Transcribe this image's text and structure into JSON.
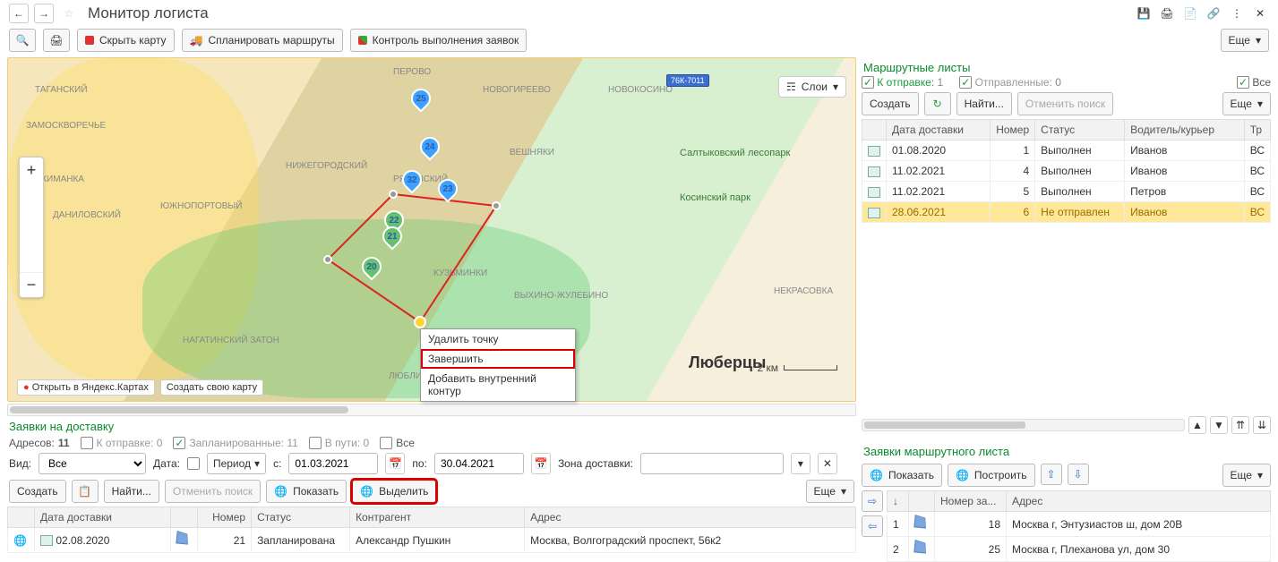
{
  "title": "Монитор логиста",
  "toolbar": {
    "hide_map": "Скрыть карту",
    "plan_routes": "Спланировать маршруты",
    "control_exec": "Контроль выполнения заявок",
    "more": "Еще"
  },
  "map": {
    "layers": "Слои",
    "context_menu": {
      "delete_point": "Удалить точку",
      "finish": "Завершить",
      "add_inner": "Добавить внутренний контур"
    },
    "open_yandex": "Открыть в Яндекс.Картах",
    "create_own": "Создать свою карту",
    "scale": "2 км",
    "city": "Люберцы",
    "park1": "Салтыковский лесопарк",
    "park2": "Косинский парк",
    "road_badge": "76К-7011",
    "districts": [
      "ТАГАНСКИЙ",
      "ЗАМОСКВОРЕЧЬЕ",
      "ЯКИМАНКА",
      "ДАНИЛОВСКИЙ",
      "ЮЖНОПОРТОВЫЙ",
      "НИЖЕГОРОДСКИЙ",
      "НОВОГИРЕЕВО",
      "ПЕРОВО",
      "НОВОКОСИНО",
      "ВЕШНЯКИ",
      "КУЗЬМИНКИ",
      "ВЫХИНО-ЖУЛЕБИНО",
      "НЕКРАСОВКА",
      "НАГАТИНСКИЙ ЗАТОН",
      "ЛЮБЛИНО",
      "РЯЗАНСКИЙ"
    ],
    "markers": [
      25,
      24,
      32,
      23,
      22,
      21,
      20
    ]
  },
  "requests": {
    "title": "Заявки на доставку",
    "addr_label": "Адресов:",
    "addr_count": "11",
    "to_send": "К отправке: 0",
    "planned_label": "Запланированные: 11",
    "in_transit": "В пути: 0",
    "all": "Все",
    "view_label": "Вид:",
    "view_value": "Все",
    "date_label": "Дата:",
    "period_label": "Период",
    "from_label": "с:",
    "from_date": "01.03.2021",
    "to_label": "по:",
    "to_date": "30.04.2021",
    "zone_label": "Зона доставки:",
    "create": "Создать",
    "find": "Найти...",
    "cancel_search": "Отменить поиск",
    "show": "Показать",
    "select": "Выделить",
    "more": "Еще",
    "columns": [
      "",
      "Дата доставки",
      "",
      "Номер",
      "Статус",
      "Контрагент",
      "Адрес"
    ],
    "rows": [
      {
        "date": "02.08.2020",
        "num": "21",
        "status": "Запланирована",
        "agent": "Александр Пушкин",
        "addr": "Москва, Волгоградский проспект, 56к2"
      }
    ]
  },
  "routes": {
    "title": "Маршрутные листы",
    "to_send_label": "К отправке:",
    "to_send_cnt": "1",
    "sent_label": "Отправленные:",
    "sent_cnt": "0",
    "all": "Все",
    "create": "Создать",
    "find": "Найти...",
    "cancel_search": "Отменить поиск",
    "more": "Еще",
    "columns": [
      "",
      "Дата доставки",
      "Номер",
      "Статус",
      "Водитель/курьер",
      "Тр"
    ],
    "rows": [
      {
        "date": "01.08.2020",
        "num": "1",
        "status": "Выполнен",
        "driver": "Иванов",
        "tr": "ВС"
      },
      {
        "date": "11.02.2021",
        "num": "4",
        "status": "Выполнен",
        "driver": "Иванов",
        "tr": "ВС"
      },
      {
        "date": "11.02.2021",
        "num": "5",
        "status": "Выполнен",
        "driver": "Петров",
        "tr": "ВС"
      },
      {
        "date": "28.06.2021",
        "num": "6",
        "status": "Не отправлен",
        "driver": "Иванов",
        "tr": "ВС"
      }
    ]
  },
  "route_requests": {
    "title": "Заявки маршрутного листа",
    "show": "Показать",
    "build": "Построить",
    "more": "Еще",
    "columns": [
      "↓",
      "",
      "Номер за...",
      "Адрес"
    ],
    "rows": [
      {
        "idx": "1",
        "num": "18",
        "addr": "Москва г, Энтузиастов ш, дом 20В"
      },
      {
        "idx": "2",
        "num": "25",
        "addr": "Москва г, Плеханова ул, дом 30"
      }
    ]
  }
}
